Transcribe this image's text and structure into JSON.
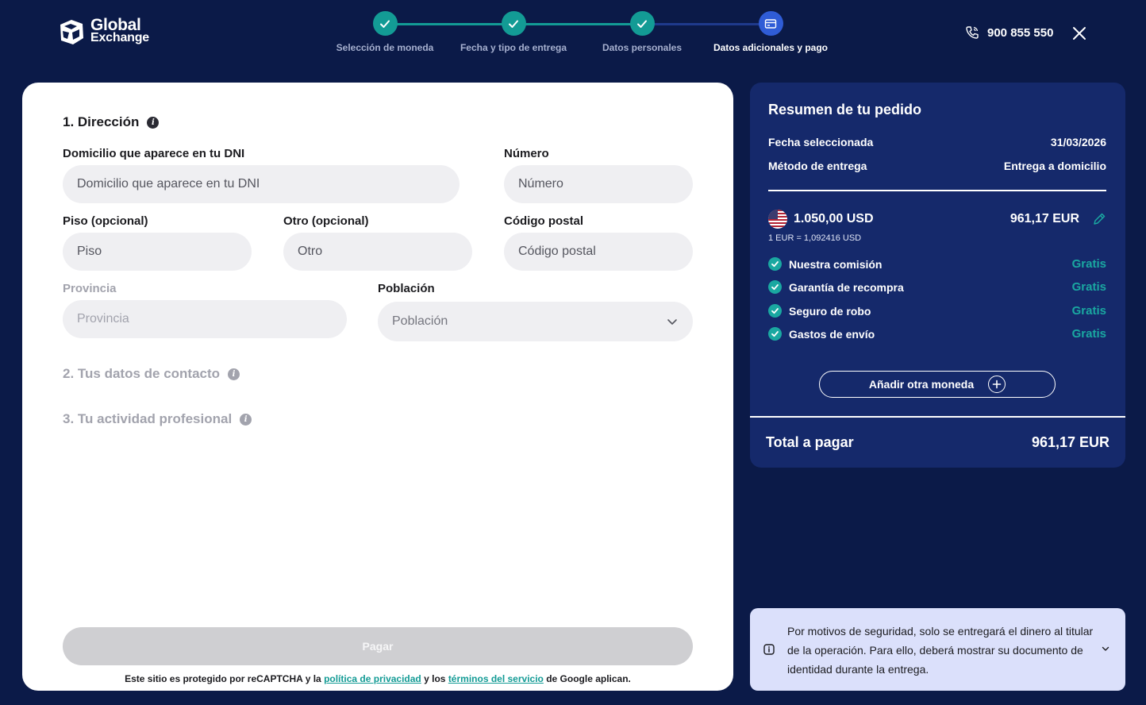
{
  "brand": {
    "line1": "Global",
    "line2": "Exchange"
  },
  "steps": [
    {
      "label": "Selección de moneda",
      "state": "done"
    },
    {
      "label": "Fecha y tipo de entrega",
      "state": "done"
    },
    {
      "label": "Datos personales",
      "state": "done"
    },
    {
      "label": "Datos adicionales y pago",
      "state": "current"
    }
  ],
  "header": {
    "phone": "900 855 550"
  },
  "colors": {
    "teal": "#139b95",
    "navy": "#0b1a48",
    "panel": "#15296b",
    "current_step": "#2f5cd6",
    "notice_bg": "#dbe0fb"
  },
  "form": {
    "section1": "1. Dirección",
    "section2": "2. Tus datos de contacto",
    "section3": "3. Tu actividad profesional",
    "domicilio": {
      "label": "Domicilio que aparece en tu DNI",
      "placeholder": "Domicilio que aparece en tu DNI"
    },
    "numero": {
      "label": "Número",
      "placeholder": "Número"
    },
    "piso": {
      "label": "Piso (opcional)",
      "placeholder": "Piso"
    },
    "otro": {
      "label": "Otro (opcional)",
      "placeholder": "Otro"
    },
    "cp": {
      "label": "Código postal",
      "placeholder": "Código postal"
    },
    "provincia": {
      "label": "Provincia",
      "placeholder": "Provincia"
    },
    "poblacion": {
      "label": "Población",
      "value": "Población"
    },
    "pay_label": "Pagar",
    "recaptcha": {
      "pre": "Este sitio es protegido por reCAPTCHA y la",
      "privacy": "política de privacidad",
      "mid": "y los",
      "terms": "términos del servicio",
      "post": "de Google aplican."
    }
  },
  "summary": {
    "title": "Resumen de tu pedido",
    "fecha_label": "Fecha seleccionada",
    "fecha_value": "31/03/2026",
    "metodo_label": "Método de entrega",
    "metodo_value": "Entrega a domicilio",
    "amount_usd": "1.050,00 USD",
    "amount_eur": "961,17 EUR",
    "rate": "1 EUR = 1,092416 USD",
    "fees": [
      {
        "label": "Nuestra comisión",
        "value": "Gratis"
      },
      {
        "label": "Garantía de recompra",
        "value": "Gratis"
      },
      {
        "label": "Seguro de robo",
        "value": "Gratis"
      },
      {
        "label": "Gastos de envío",
        "value": "Gratis"
      }
    ],
    "add_currency": "Añadir otra moneda",
    "total_label": "Total a pagar",
    "total_value": "961,17 EUR"
  },
  "notice": {
    "text": "Por motivos de seguridad, solo se entregará el dinero al titular de la operación. Para ello, deberá mostrar su documento de identidad durante la entrega."
  }
}
